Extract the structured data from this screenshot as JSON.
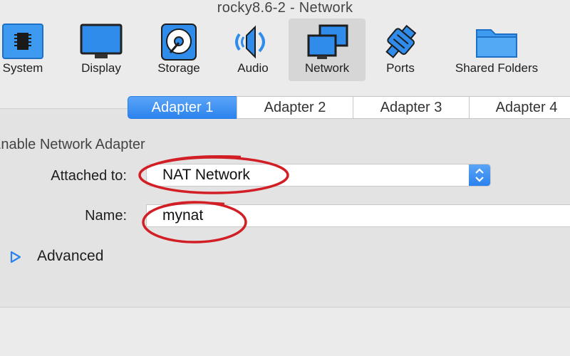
{
  "window": {
    "title": "rocky8.6-2 - Network"
  },
  "toolbar": {
    "items": [
      {
        "label": "System",
        "icon": "chip-icon"
      },
      {
        "label": "Display",
        "icon": "monitor-icon"
      },
      {
        "label": "Storage",
        "icon": "hard-disk-icon"
      },
      {
        "label": "Audio",
        "icon": "speaker-icon"
      },
      {
        "label": "Network",
        "icon": "network-icon",
        "selected": true
      },
      {
        "label": "Ports",
        "icon": "serial-port-icon"
      },
      {
        "label": "Shared Folders",
        "icon": "folder-icon"
      }
    ]
  },
  "tabs": [
    {
      "label": "Adapter 1",
      "active": true
    },
    {
      "label": "Adapter 2"
    },
    {
      "label": "Adapter 3"
    },
    {
      "label": "Adapter 4"
    }
  ],
  "form": {
    "enable_label": "Enable Network Adapter",
    "attached_to_label": "Attached to:",
    "attached_to_value": "NAT Network",
    "name_label": "Name:",
    "name_value": "mynat",
    "advanced_label": "Advanced"
  },
  "colors": {
    "accent": "#2c83ee",
    "annotation": "#d21f26",
    "background": "#ebebeb"
  }
}
